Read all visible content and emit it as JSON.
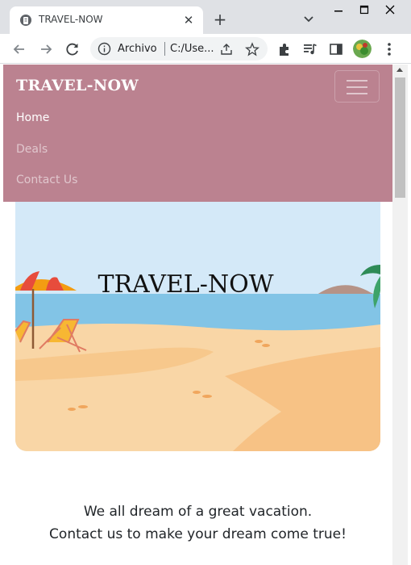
{
  "browser": {
    "tab_title": "TRAVEL-NOW",
    "omnibox_label": "Archivo",
    "omnibox_url": "C:/Use...",
    "new_tab_symbol": "+",
    "close_symbol": "✕"
  },
  "navbar": {
    "brand": "TRAVEL-NOW",
    "links": [
      {
        "label": "Home",
        "active": true
      },
      {
        "label": "Deals",
        "active": false
      },
      {
        "label": "Contact Us",
        "active": false
      }
    ]
  },
  "hero": {
    "title": "TRAVEL-NOW"
  },
  "tagline": {
    "line1": "We all dream of a great vacation.",
    "line2": "Contact us to make your dream come true!"
  },
  "colors": {
    "navbar_bg": "#bb8290",
    "sky": "#d4e9f8",
    "sea": "#82c4e6",
    "sand": "#f9d6a6"
  }
}
